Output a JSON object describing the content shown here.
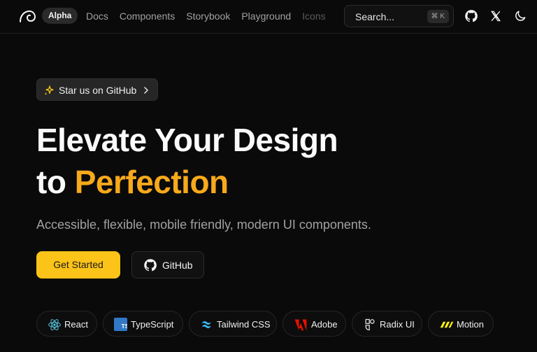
{
  "nav": {
    "badge": "Alpha",
    "links": [
      "Docs",
      "Components",
      "Storybook",
      "Playground",
      "Icons"
    ],
    "search_placeholder": "Search...",
    "search_shortcut": "⌘ K",
    "icons": [
      "logo-icon",
      "github-icon",
      "x-icon",
      "moon-icon"
    ]
  },
  "hero": {
    "announcement": "Star us on GitHub",
    "headline_line1": "Elevate Your Design",
    "headline_line2_prefix": "to ",
    "headline_line2_accent": "Perfection",
    "subtitle": "Accessible, flexible, mobile friendly, modern UI components.",
    "cta_primary": "Get Started",
    "cta_secondary": "GitHub",
    "accent_color": "#f6a91b",
    "primary_button_color": "#fcc318"
  },
  "tech": [
    {
      "label": "React",
      "icon": "react-icon"
    },
    {
      "label": "TypeScript",
      "icon": "typescript-icon"
    },
    {
      "label": "Tailwind CSS",
      "icon": "tailwind-icon"
    },
    {
      "label": "Adobe",
      "icon": "adobe-icon"
    },
    {
      "label": "Radix UI",
      "icon": "radix-icon"
    },
    {
      "label": "Motion",
      "icon": "motion-icon"
    }
  ]
}
